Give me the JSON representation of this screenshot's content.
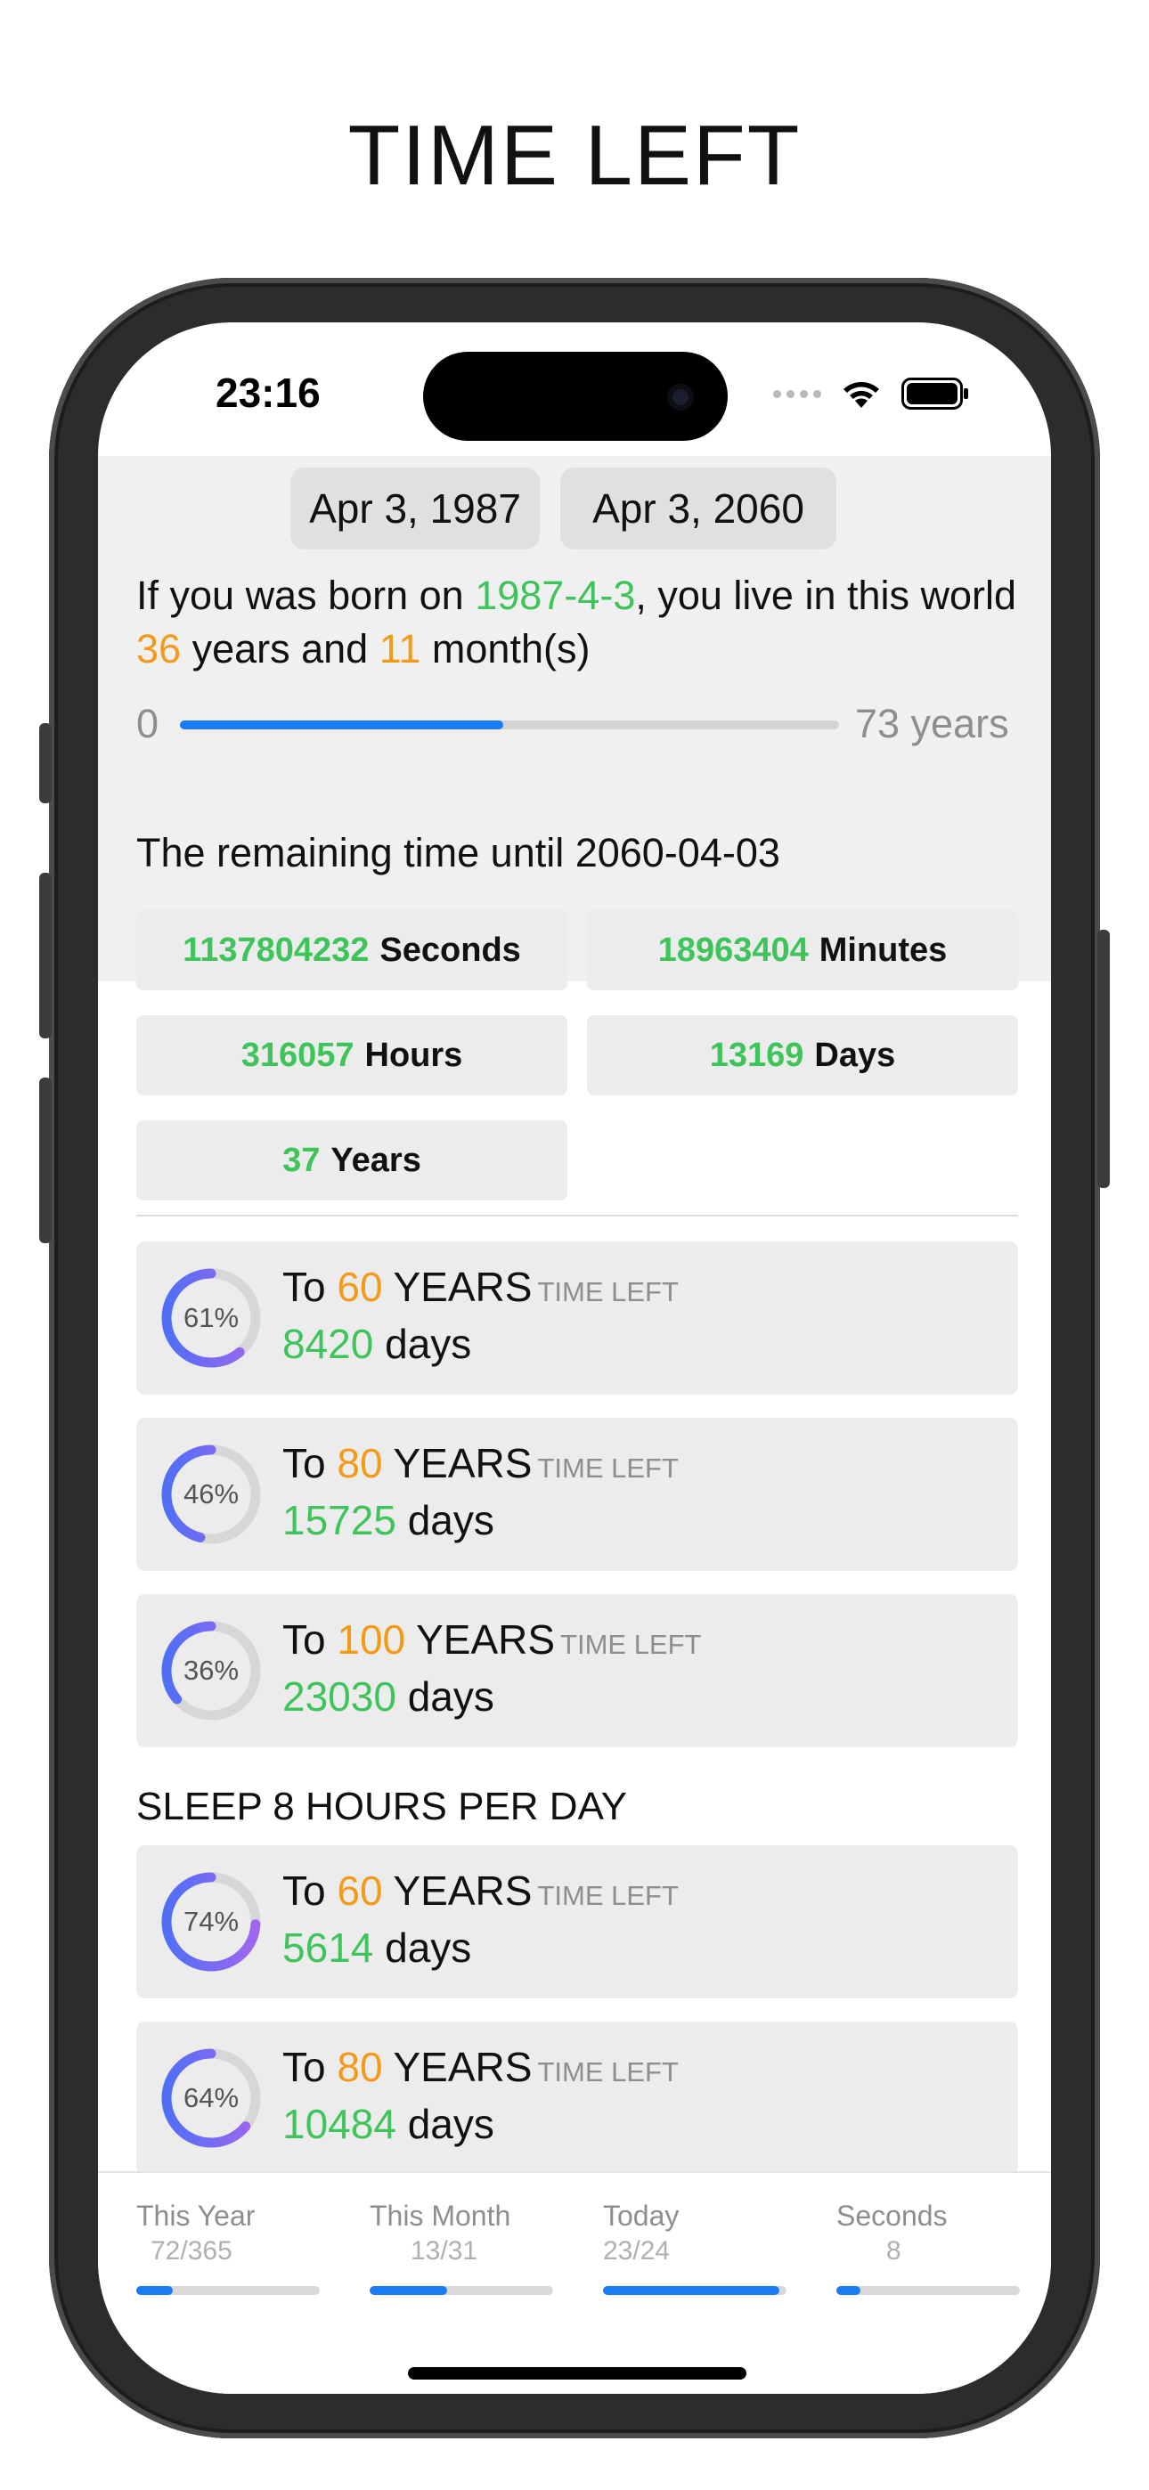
{
  "page_title": "TIME LEFT",
  "status_bar": {
    "time": "23:16"
  },
  "dates": {
    "birth": "Apr 3, 1987",
    "end": "Apr 3, 2060"
  },
  "intro": {
    "prefix": "If you was born on ",
    "birth_date": "1987-4-3",
    "middle": ", you live in this world ",
    "years": "36",
    "years_word": " years and ",
    "months": "11",
    "months_word": " month(s)"
  },
  "life_range": {
    "min_label": "0",
    "max_label": "73 years",
    "progress": 0.49
  },
  "remaining": {
    "title": "The remaining time until 2060-04-03",
    "stats": [
      {
        "value": "1137804232",
        "unit": "Seconds"
      },
      {
        "value": "18963404",
        "unit": "Minutes"
      },
      {
        "value": "316057",
        "unit": "Hours"
      },
      {
        "value": "13169",
        "unit": "Days"
      },
      {
        "value": "37",
        "unit": "Years"
      }
    ]
  },
  "goals": [
    {
      "percent_label": "61%",
      "percent": 61,
      "to": "To ",
      "age": "60",
      "years_word": " YEARS",
      "time_left": "TIME LEFT",
      "days": "8420",
      "days_word": " days"
    },
    {
      "percent_label": "46%",
      "percent": 46,
      "to": "To ",
      "age": "80",
      "years_word": " YEARS",
      "time_left": "TIME LEFT",
      "days": "15725",
      "days_word": " days"
    },
    {
      "percent_label": "36%",
      "percent": 36,
      "to": "To ",
      "age": "100",
      "years_word": " YEARS",
      "time_left": "TIME LEFT",
      "days": "23030",
      "days_word": " days"
    }
  ],
  "sleep_heading": "SLEEP 8 HOURS PER DAY",
  "sleep_goals": [
    {
      "percent_label": "74%",
      "percent": 74,
      "to": "To ",
      "age": "60",
      "years_word": " YEARS",
      "time_left": "TIME LEFT",
      "days": "5614",
      "days_word": " days"
    },
    {
      "percent_label": "64%",
      "percent": 64,
      "to": "To ",
      "age": "80",
      "years_word": " YEARS",
      "time_left": "TIME LEFT",
      "days": "10484",
      "days_word": " days"
    }
  ],
  "bottom_bar": [
    {
      "label": "This Year",
      "value": "72/365",
      "progress": 0.2
    },
    {
      "label": "This Month",
      "value": "13/31",
      "progress": 0.42
    },
    {
      "label": "Today",
      "value": "23/24",
      "progress": 0.96
    },
    {
      "label": "Seconds",
      "value": "8",
      "progress": 0.13
    }
  ],
  "colors": {
    "green": "#3ec45b",
    "orange": "#f49a1a",
    "blue": "#1a7cf5",
    "ring_start": "#a066f0",
    "ring_end": "#4f6ff5"
  }
}
